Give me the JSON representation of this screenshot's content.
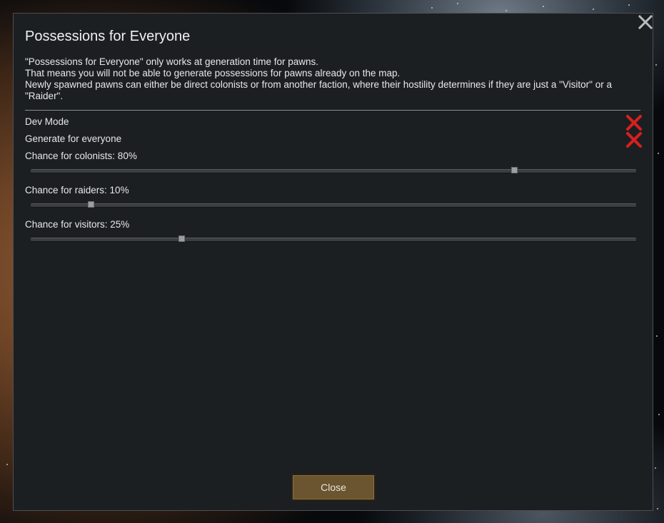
{
  "window": {
    "title": "Possessions for Everyone",
    "close_icon": "close-icon"
  },
  "description": {
    "line1": "\"Possessions for Everyone\" only works at generation time for pawns.",
    "line2": "That means you will not be able to generate possessions for pawns already on the map.",
    "line3": "Newly spawned pawns can either be direct colonists or from another faction, where their hostility determines if they are just a \"Visitor\" or a \"Raider\"."
  },
  "settings": {
    "dev_mode": {
      "label": "Dev Mode",
      "checked": false,
      "icon": "red-x-icon"
    },
    "generate_everyone": {
      "label": "Generate for everyone",
      "checked": false,
      "icon": "red-x-icon"
    },
    "colonists": {
      "label": "Chance for colonists: 80%",
      "value_percent": 80
    },
    "raiders": {
      "label": "Chance for raiders: 10%",
      "value_percent": 10
    },
    "visitors": {
      "label": "Chance for visitors: 25%",
      "value_percent": 25
    }
  },
  "footer": {
    "close_label": "Close"
  },
  "colors": {
    "dialog_bg": "#1c1f22",
    "checkbox_off": "#d8201e",
    "button_bg": "#6b5530"
  }
}
